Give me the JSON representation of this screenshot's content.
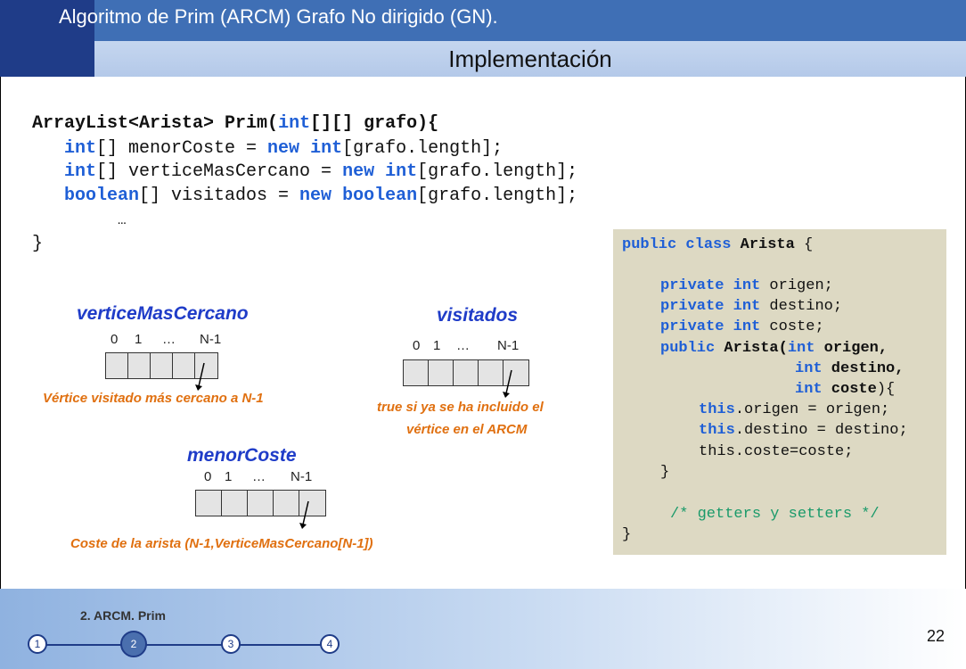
{
  "header": {
    "title": "Algoritmo de Prim (ARCM) Grafo No dirigido (GN).",
    "subtitle": "Implementación"
  },
  "code": {
    "l1": {
      "type": "ArrayList<Arista>",
      "name": " Prim(",
      "kw": "int",
      "rest": "[][] grafo){"
    },
    "l2": {
      "kw1": "int",
      "a": "[] menorCoste = ",
      "kw2": "new",
      "sp": " ",
      "kw3": "int",
      "b": "[grafo.length];"
    },
    "l3": {
      "kw1": "int",
      "a": "[] verticeMasCercano = ",
      "kw2": "new",
      "sp": " ",
      "kw3": "int",
      "b": "[grafo.length];"
    },
    "l4": {
      "kw1": "boolean",
      "a": "[] visitados = ",
      "kw2": "new",
      "sp": " ",
      "kw3": "boolean",
      "b": "[grafo.length];"
    },
    "l5": "…",
    "l6": "}"
  },
  "class_box": {
    "l1": {
      "kw": "public class",
      "name": "Arista",
      "rest": " {"
    },
    "l2": {
      "kw1": "private",
      "kw2": "int",
      "rest": " origen;"
    },
    "l3": {
      "kw1": "private",
      "kw2": "int",
      "rest": " destino;"
    },
    "l4": {
      "kw1": "private",
      "kw2": "int",
      "rest": " coste;"
    },
    "l5": {
      "kw1": "public",
      "name": "Arista(",
      "kw2": "int",
      "b": " origen,"
    },
    "l6": {
      "kw2": "int",
      "b": " destino,"
    },
    "l7": {
      "kw2": "int",
      "b": " coste",
      "rest": "){"
    },
    "l8": {
      "kw": "this",
      "rest": ".origen = origen;"
    },
    "l9": {
      "kw": "this",
      "rest": ".destino = destino;"
    },
    "l10": "this.coste=coste;",
    "l11": "}",
    "l12": "/* getters y setters */",
    "l13": "}"
  },
  "arrays": [
    {
      "title": "verticeMasCercano",
      "i0": "0",
      "i1": "1",
      "dots": "…",
      "last": "N-1",
      "note": "Vértice visitado más cercano a N-1"
    },
    {
      "title": "visitados",
      "i0": "0",
      "i1": "1",
      "dots": "…",
      "last": "N-1",
      "note1": "true si ya se ha incluido el",
      "note2": "vértice en el ARCM"
    },
    {
      "title": "menorCoste",
      "i0": "0",
      "i1": "1",
      "dots": "…",
      "last": "N-1",
      "note": "Coste de la arista (N-1,VerticeMasCercano[N-1])"
    }
  ],
  "footer": {
    "section": "2. ARCM. Prim",
    "steps": [
      "1",
      "2",
      "3",
      "4"
    ],
    "active_step": 2,
    "page": "22"
  }
}
